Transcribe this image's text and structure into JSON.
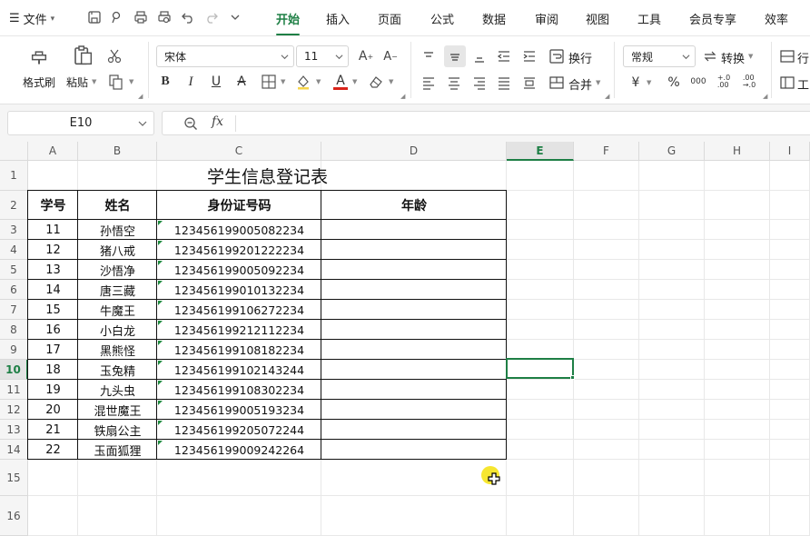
{
  "menubar": {
    "file_label": "文件",
    "tabs": [
      "开始",
      "插入",
      "页面",
      "公式",
      "数据",
      "审阅",
      "视图",
      "工具",
      "会员专享",
      "效率"
    ],
    "active_tab": "开始"
  },
  "ribbon": {
    "format_painter": "格式刷",
    "paste": "粘贴",
    "font_name": "宋体",
    "font_size": "11",
    "wrap_text": "换行",
    "merge": "合并",
    "number_format": "常规",
    "convert": "转换",
    "row_col_partial": "行",
    "tools_partial": "工",
    "font_color": "#d9231a"
  },
  "formula_bar": {
    "name_box": "E10",
    "fx_label": "fx",
    "formula": ""
  },
  "sheet": {
    "columns": [
      "A",
      "B",
      "C",
      "D",
      "E",
      "F",
      "G",
      "H",
      "I"
    ],
    "rows": [
      "1",
      "2",
      "3",
      "4",
      "5",
      "6",
      "7",
      "8",
      "9",
      "10",
      "11",
      "12",
      "13",
      "14",
      "15",
      "16"
    ],
    "selected_column": "E",
    "selected_row": "10",
    "table_title": "学生信息登记表",
    "headers": [
      "学号",
      "姓名",
      "身份证号码",
      "年龄"
    ],
    "records": [
      [
        "11",
        "孙悟空",
        "123456199005082234",
        ""
      ],
      [
        "12",
        "猪八戒",
        "123456199201222234",
        ""
      ],
      [
        "13",
        "沙悟净",
        "123456199005092234",
        ""
      ],
      [
        "14",
        "唐三藏",
        "123456199010132234",
        ""
      ],
      [
        "15",
        "牛魔王",
        "123456199106272234",
        ""
      ],
      [
        "16",
        "小白龙",
        "123456199212112234",
        ""
      ],
      [
        "17",
        "黑熊怪",
        "123456199108182234",
        ""
      ],
      [
        "18",
        "玉兔精",
        "123456199102143244",
        ""
      ],
      [
        "19",
        "九头虫",
        "123456199108302234",
        ""
      ],
      [
        "20",
        "混世魔王",
        "123456199005193234",
        ""
      ],
      [
        "21",
        "铁扇公主",
        "123456199205072244",
        ""
      ],
      [
        "22",
        "玉面狐狸",
        "123456199009242264",
        ""
      ]
    ],
    "accent_color": "#1e7f45"
  }
}
